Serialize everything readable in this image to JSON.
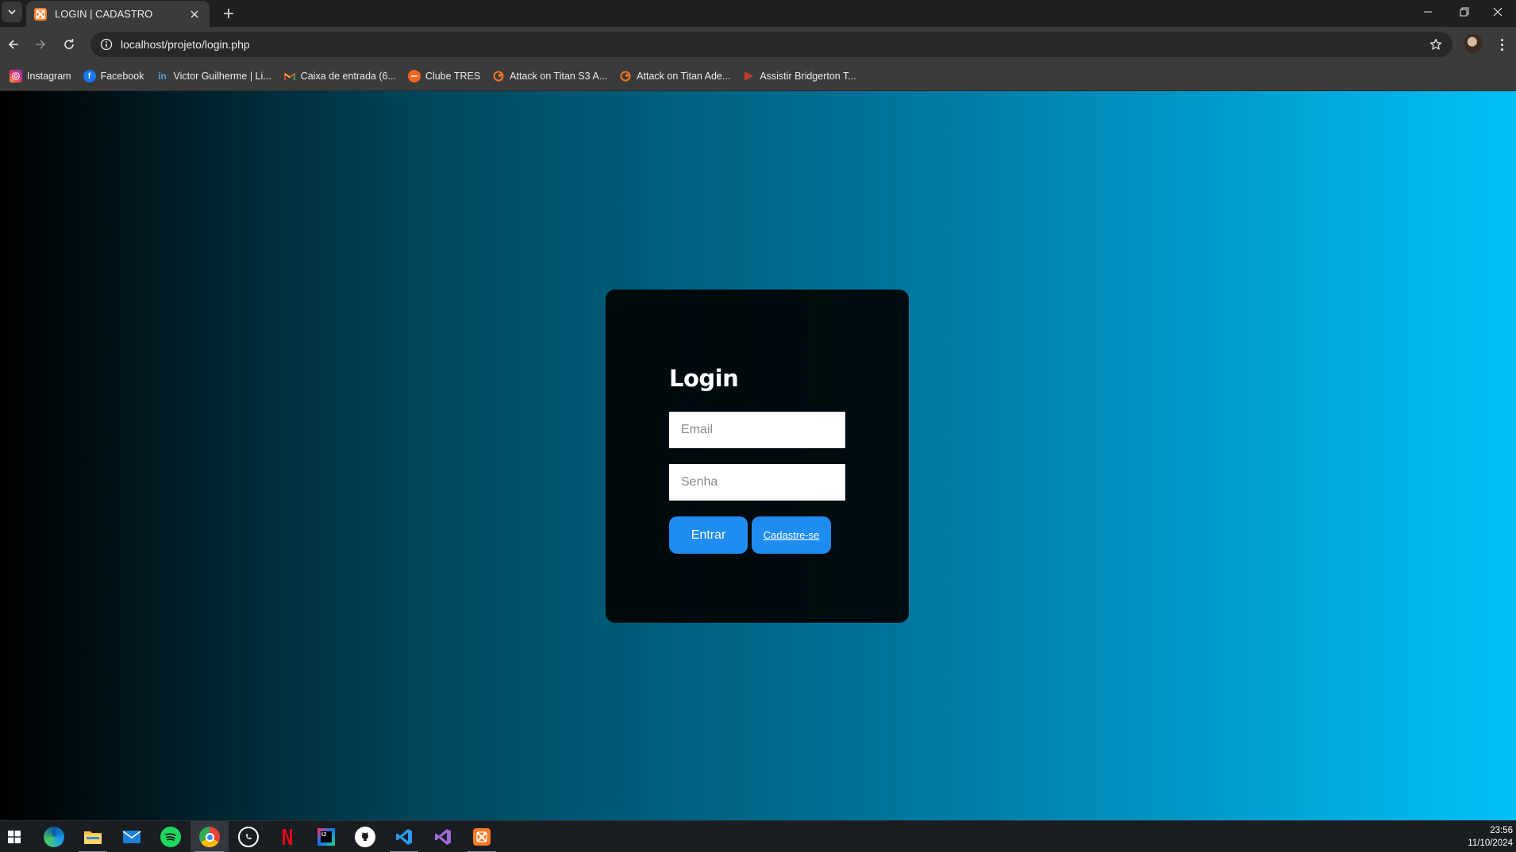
{
  "browser": {
    "tab": {
      "title": "LOGIN | CADASTRO",
      "favicon": "xampp-icon"
    },
    "address_bar": {
      "url": "localhost/projeto/login.php"
    },
    "bookmarks": [
      {
        "label": "Instagram",
        "icon": "instagram-icon",
        "color": "#e1306c"
      },
      {
        "label": "Facebook",
        "icon": "facebook-icon",
        "color": "#1877f2"
      },
      {
        "label": "Victor Guilherme | Li...",
        "icon": "linkedin-icon",
        "color": "#0a66c2"
      },
      {
        "label": "Caixa de entrada (6...",
        "icon": "gmail-icon",
        "color": "#ea4335"
      },
      {
        "label": "Clube TRES",
        "icon": "clube-tres-icon",
        "color": "#f26522"
      },
      {
        "label": "Attack on Titan S3 A...",
        "icon": "crunchyroll-icon",
        "color": "#f47521"
      },
      {
        "label": "Attack on Titan Ade...",
        "icon": "crunchyroll-icon",
        "color": "#f47521"
      },
      {
        "label": "Assistir Bridgerton T...",
        "icon": "play-icon",
        "color": "#c0392b"
      }
    ]
  },
  "page": {
    "login_card": {
      "title": "Login",
      "email_placeholder": "Email",
      "password_placeholder": "Senha",
      "submit_label": "Entrar",
      "signup_label": "Cadastre-se"
    },
    "colors": {
      "gradient_start": "#000000",
      "gradient_end": "#00c0f7",
      "button_blue": "#1e8cf0"
    }
  },
  "taskbar": {
    "apps": [
      "windows-start-icon",
      "edge-icon",
      "file-explorer-icon",
      "mail-icon",
      "spotify-icon",
      "chrome-icon",
      "whatsapp-icon",
      "netflix-icon",
      "intellij-icon",
      "github-icon",
      "vscode-icon",
      "visual-studio-icon",
      "xampp-icon"
    ],
    "time": "23:56",
    "date": "11/10/2024"
  }
}
